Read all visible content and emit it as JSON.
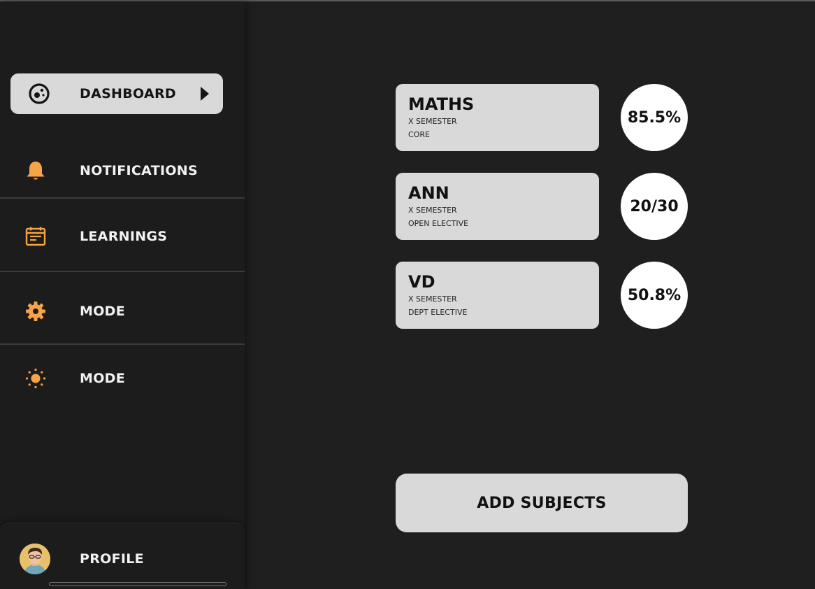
{
  "colors": {
    "accent": "#f5a44a",
    "background": "#1f1f1f",
    "card": "#d9d9d9",
    "text_light": "#f2f2f2",
    "text_dark": "#111111"
  },
  "sidebar": {
    "items": [
      {
        "label": "DASHBOARD",
        "icon": "dashboard-gauge-icon",
        "active": true
      },
      {
        "label": "NOTIFICATIONS",
        "icon": "bell-icon",
        "active": false
      },
      {
        "label": "LEARNINGS",
        "icon": "calendar-list-icon",
        "active": false
      },
      {
        "label": "MODE",
        "icon": "gear-icon",
        "active": false
      },
      {
        "label": "MODE",
        "icon": "sun-icon",
        "active": false
      }
    ],
    "profile": {
      "label": "PROFILE",
      "icon": "avatar"
    }
  },
  "subjects": [
    {
      "name": "MATHS",
      "semester": "X SEMESTER",
      "type": "CORE",
      "score": "85.5%"
    },
    {
      "name": "ANN",
      "semester": "X SEMESTER",
      "type": "OPEN ELECTIVE",
      "score": "20/30"
    },
    {
      "name": "VD",
      "semester": "X SEMESTER",
      "type": "DEPT ELECTIVE",
      "score": "50.8%"
    }
  ],
  "actions": {
    "add_subjects_label": "ADD SUBJECTS"
  }
}
